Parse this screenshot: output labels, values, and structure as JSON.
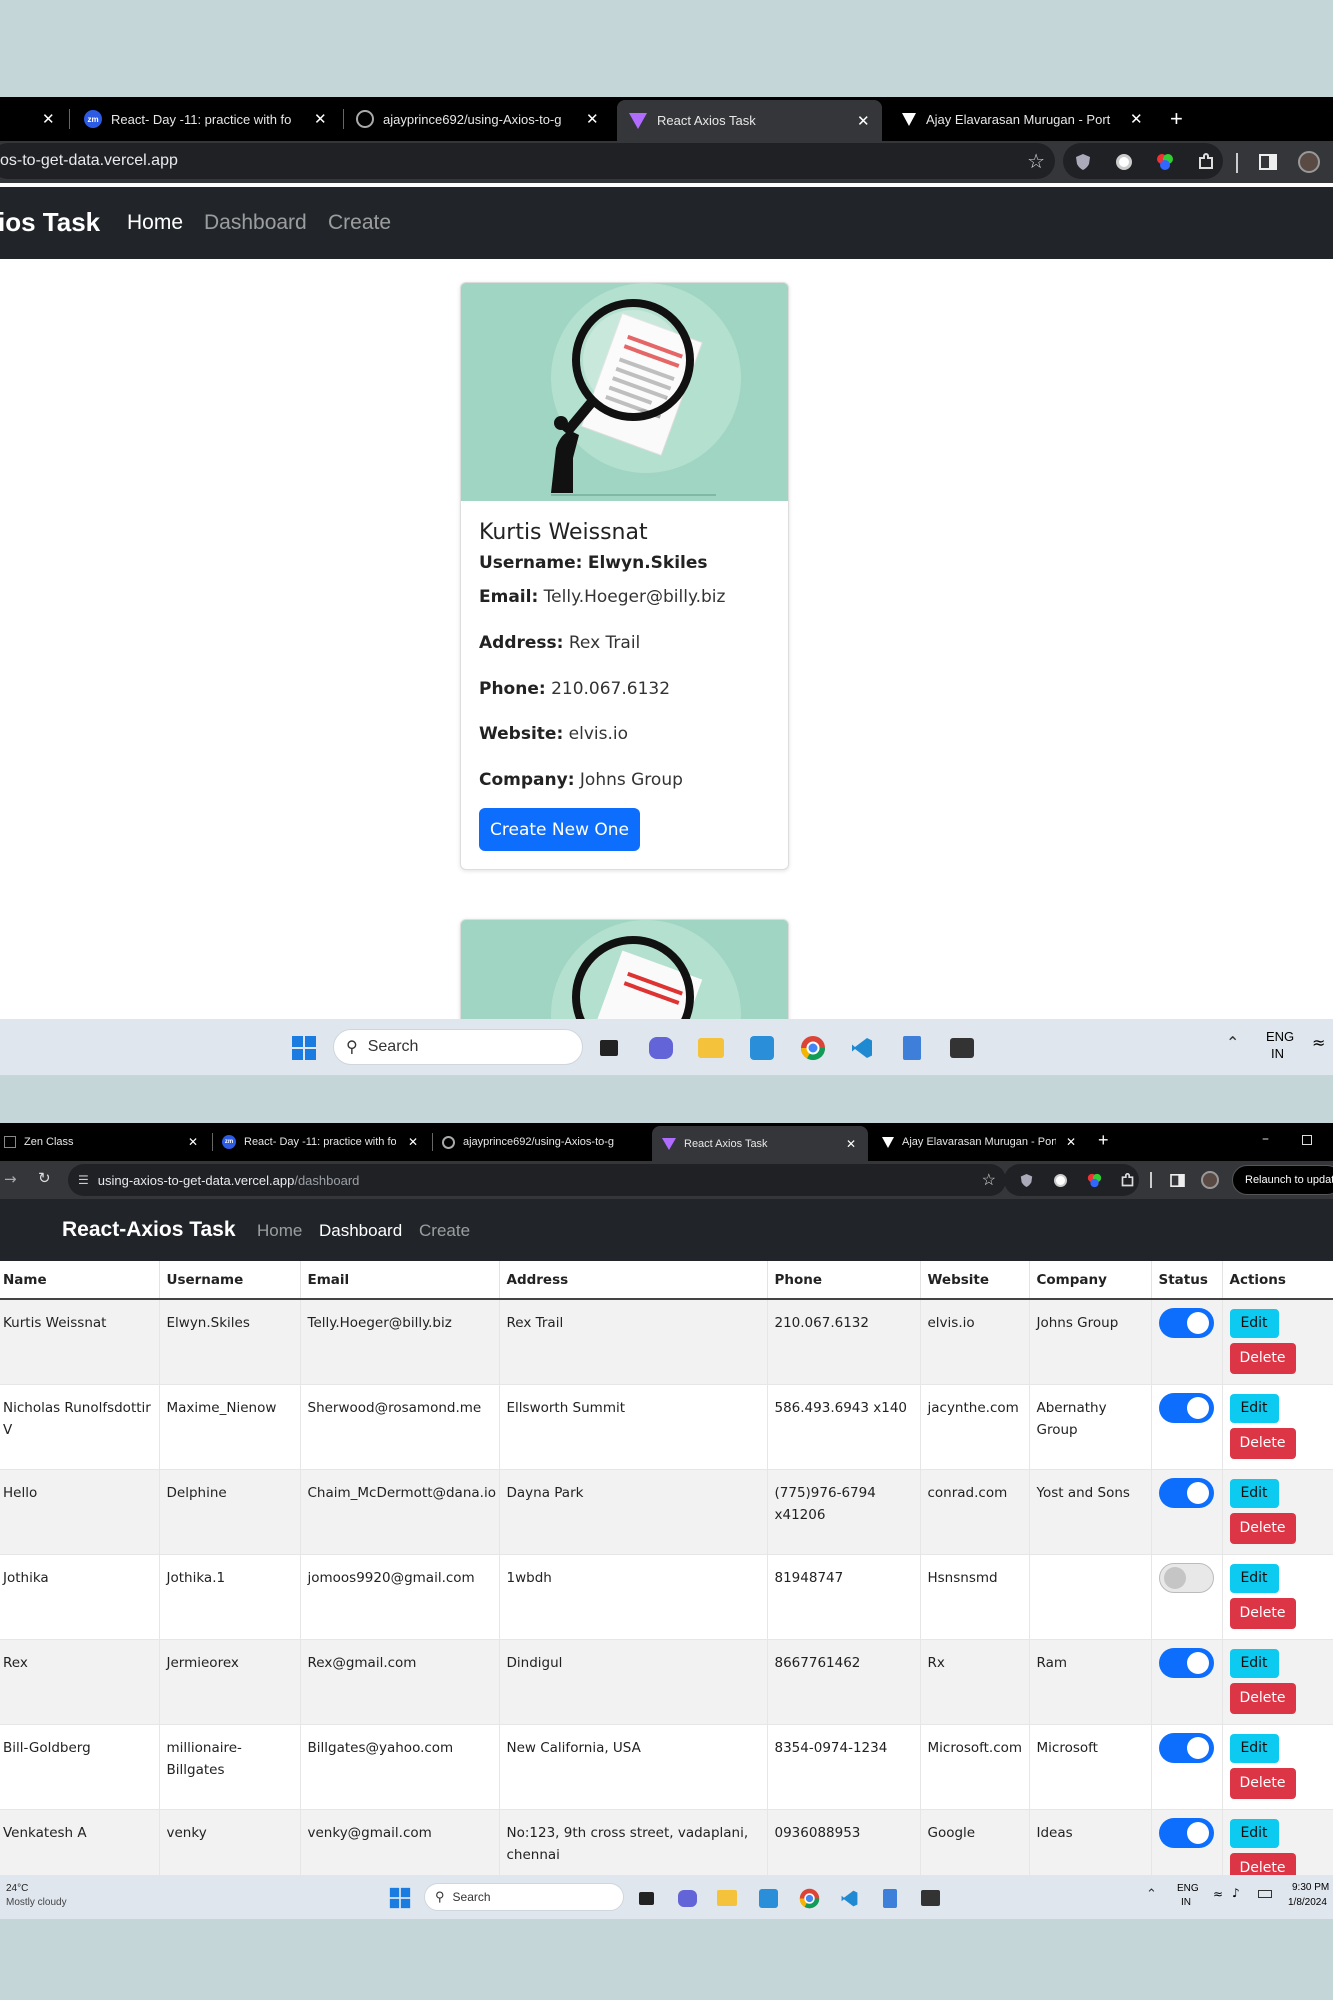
{
  "top": {
    "tabs": [
      {
        "title": "",
        "close": "✕"
      },
      {
        "title": "React- Day -11: practice with fo",
        "close": "✕",
        "favicon": "zm"
      },
      {
        "title": "ajayprince692/using-Axios-to-g",
        "close": "✕"
      },
      {
        "title": "React Axios Task",
        "close": "✕"
      },
      {
        "title": "Ajay Elavarasan Murugan - Port",
        "close": "✕"
      }
    ],
    "new_tab": "+",
    "url": "os-to-get-data.vercel.app",
    "brand": "ios Task",
    "nav": [
      "Home",
      "Dashboard",
      "Create"
    ],
    "card": {
      "name": "Kurtis Weissnat",
      "username_label": "Username:",
      "username": "Elwyn.Skiles",
      "email_label": "Email:",
      "email": "Telly.Hoeger@billy.biz",
      "address_label": "Address:",
      "address": "Rex Trail",
      "phone_label": "Phone:",
      "phone": "210.067.6132",
      "website_label": "Website:",
      "website": "elvis.io",
      "company_label": "Company:",
      "company": "Johns Group",
      "button": "Create New One"
    },
    "taskbar": {
      "search": "Search",
      "lang1": "ENG",
      "lang2": "IN"
    }
  },
  "bottom": {
    "tabs": [
      {
        "title": "Zen Class",
        "close": "✕"
      },
      {
        "title": "React- Day -11: practice with fo",
        "close": "✕",
        "favicon": "zm"
      },
      {
        "title": "ajayprince692/using-Axios-to-g",
        "close": "✕"
      },
      {
        "title": "React Axios Task",
        "close": "✕"
      },
      {
        "title": "Ajay Elavarasan Murugan - Port",
        "close": "✕"
      }
    ],
    "new_tab": "+",
    "url_host": "using-axios-to-get-data.vercel.app",
    "url_path": "/dashboard",
    "relaunch": "Relaunch to updat",
    "brand": "React-Axios Task",
    "nav": [
      "Home",
      "Dashboard",
      "Create"
    ],
    "table": {
      "headers": [
        "Name",
        "Username",
        "Email",
        "Address",
        "Phone",
        "Website",
        "Company",
        "Status",
        "Actions"
      ],
      "edit_label": "Edit",
      "delete_label": "Delete",
      "rows": [
        {
          "name": "Kurtis Weissnat",
          "username": "Elwyn.Skiles",
          "email": "Telly.Hoeger@billy.biz",
          "address": "Rex Trail",
          "phone": "210.067.6132",
          "website": "elvis.io",
          "company": "Johns Group",
          "status": true
        },
        {
          "name": "Nicholas Runolfsdottir V",
          "username": "Maxime_Nienow",
          "email": "Sherwood@rosamond.me",
          "address": "Ellsworth Summit",
          "phone": "586.493.6943 x140",
          "website": "jacynthe.com",
          "company": "Abernathy Group",
          "status": true
        },
        {
          "name": "Hello",
          "username": "Delphine",
          "email": "Chaim_McDermott@dana.io",
          "address": "Dayna Park",
          "phone": "(775)976-6794 x41206",
          "website": "conrad.com",
          "company": "Yost and Sons",
          "status": true
        },
        {
          "name": "Jothika",
          "username": "Jothika.1",
          "email": "jomoos9920@gmail.com",
          "address": "1wbdh",
          "phone": "81948747",
          "website": "Hsnsnsmd",
          "company": "",
          "status": false
        },
        {
          "name": "Rex",
          "username": "Jermieorex",
          "email": "Rex@gmail.com",
          "address": "Dindigul",
          "phone": "8667761462",
          "website": "Rx",
          "company": "Ram",
          "status": true
        },
        {
          "name": "Bill-Goldberg",
          "username": "millionaire-Billgates",
          "email": "Billgates@yahoo.com",
          "address": "New California, USA",
          "phone": "8354-0974-1234",
          "website": "Microsoft.com",
          "company": "Microsoft",
          "status": true
        },
        {
          "name": "Venkatesh A",
          "username": "venky",
          "email": "venky@gmail.com",
          "address": "No:123, 9th cross street, vadaplani, chennai",
          "phone": "0936088953",
          "website": "Google",
          "company": "Ideas",
          "status": true
        }
      ]
    },
    "taskbar": {
      "weather_temp": "24°C",
      "weather_desc": "Mostly cloudy",
      "search": "Search",
      "lang1": "ENG",
      "lang2": "IN",
      "time": "9:30 PM",
      "date": "1/8/2024"
    }
  }
}
